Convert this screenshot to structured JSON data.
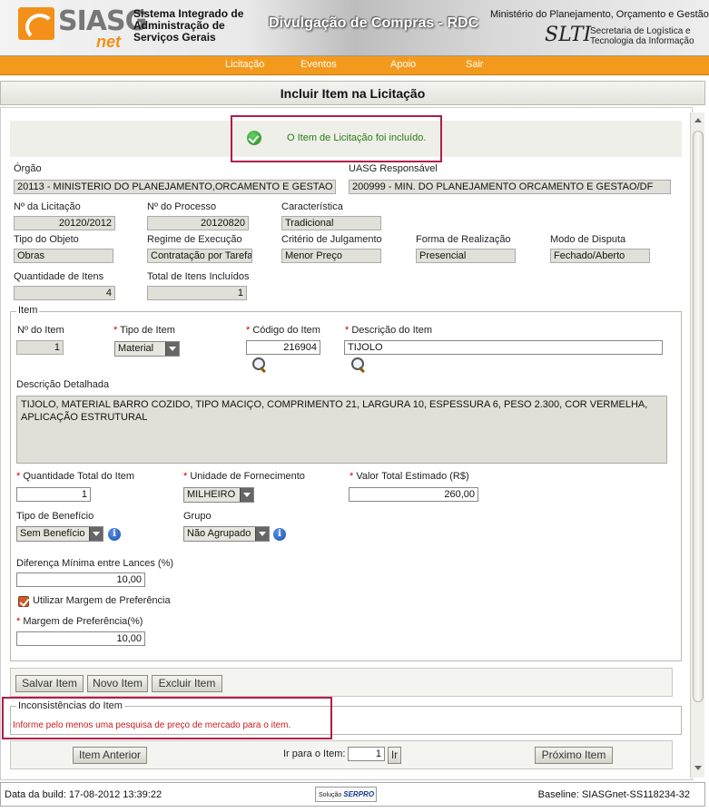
{
  "header": {
    "logo_text": "SIASG",
    "logo_sub": "net",
    "system_name": "Sistema Integrado de Administração de Serviços Gerais",
    "title": "Divulgação de Compras - RDC",
    "ministry": "Ministério do Planejamento, Orçamento e Gestão",
    "slti": "SLTI",
    "slti_sub": "Secretaria de Logística e Tecnologia da Informação"
  },
  "menu": [
    {
      "label": "Licitação"
    },
    {
      "label": "Eventos"
    },
    {
      "label": "Apoio"
    },
    {
      "label": "Sair"
    }
  ],
  "page_title": "Incluir Item na Licitação",
  "success_message": "O Item de Licitação foi incluído.",
  "licitacao": {
    "orgao_label": "Órgão",
    "orgao_value": "20113 - MINISTERIO DO PLANEJAMENTO,ORCAMENTO E GESTAO",
    "uasg_label": "UASG Responsável",
    "uasg_value": "200999 - MIN. DO PLANEJAMENTO ORCAMENTO E GESTAO/DF",
    "num_licitacao_label": "Nº da Licitação",
    "num_licitacao_value": "20120/2012",
    "num_processo_label": "Nº do Processo",
    "num_processo_value": "20120820",
    "caracteristica_label": "Característica",
    "caracteristica_value": "Tradicional",
    "tipo_objeto_label": "Tipo do Objeto",
    "tipo_objeto_value": "Obras",
    "regime_label": "Regime de Execução",
    "regime_value": "Contratação por Tarefa",
    "criterio_label": "Critério de Julgamento",
    "criterio_value": "Menor Preço",
    "forma_label": "Forma de Realização",
    "forma_value": "Presencial",
    "modo_label": "Modo de Disputa",
    "modo_value": "Fechado/Aberto",
    "qtd_itens_label": "Quantidade de Itens",
    "qtd_itens_value": "4",
    "total_incluidos_label": "Total de Itens Incluídos",
    "total_incluidos_value": "1"
  },
  "item": {
    "legend": "Item",
    "num_item_label": "Nº do Item",
    "num_item_value": "1",
    "tipo_item_label": "Tipo de Item",
    "tipo_item_value": "Material",
    "codigo_label": "Código do Item",
    "codigo_value": "216904",
    "descricao_label": "Descrição do Item",
    "descricao_value": "TIJOLO",
    "desc_detalhada_label": "Descrição Detalhada",
    "desc_detalhada_value": "TIJOLO, MATERIAL BARRO COZIDO, TIPO MACIÇO, COMPRIMENTO 21, LARGURA 10, ESPESSURA 6, PESO 2.300, COR VERMELHA, APLICAÇÃO ESTRUTURAL",
    "qtd_total_label": "Quantidade Total do Item",
    "qtd_total_value": "1",
    "unidade_label": "Unidade de Fornecimento",
    "unidade_value": "MILHEIRO",
    "valor_label": "Valor Total Estimado (R$)",
    "valor_value": "260,00",
    "beneficio_label": "Tipo de Benefício",
    "beneficio_value": "Sem Benefício",
    "grupo_label": "Grupo",
    "grupo_value": "Não Agrupado",
    "diferenca_label": "Diferença Mínima entre Lances (%)",
    "diferenca_value": "10,00",
    "margem_check_label": "Utilizar Margem de Preferência",
    "margem_label": "Margem de Preferência(%)",
    "margem_value": "10,00"
  },
  "buttons": {
    "salvar": "Salvar Item",
    "novo": "Novo Item",
    "excluir": "Excluir Item",
    "anterior": "Item Anterior",
    "ir_para_label": "Ir para o Item:",
    "ir_para_value": "1",
    "ir": "Ir",
    "proximo": "Próximo Item"
  },
  "inconsistencias": {
    "legend": "Inconsistências do Item",
    "message": "Informe pelo menos uma pesquisa de preço de mercado para o item."
  },
  "footer": {
    "build": "Data da build: 17-08-2012 13:39:22",
    "solucao": "Solução",
    "serpro": "SERPRO",
    "baseline": "Baseline: SIASGnet-SS118234-32"
  }
}
